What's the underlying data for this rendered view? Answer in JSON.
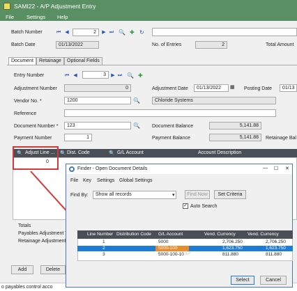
{
  "window": {
    "title": "SAMI22 - A/P Adjustment Entry"
  },
  "menu": [
    "File",
    "Settings",
    "Help"
  ],
  "batch": {
    "number_label": "Batch Number",
    "number_value": "2",
    "date_label": "Batch Date",
    "date_value": "01/13/2022",
    "entries_label": "No. of Entries",
    "entries_value": "2",
    "total_label": "Total Amount"
  },
  "tabs": [
    "Document",
    "Retainage",
    "Optional Fields"
  ],
  "entry": {
    "label": "Entry Number",
    "value": "3"
  },
  "adj_number": {
    "label": "Adjustment Number",
    "value": "0"
  },
  "adj_date": {
    "label": "Adjustment Date",
    "value": "01/13/2022"
  },
  "posting_date": {
    "label": "Posting Date",
    "value": "01/13"
  },
  "vendor": {
    "label": "Vendor No. *",
    "value": "1200",
    "name": "Chloride Systems"
  },
  "reference": {
    "label": "Reference"
  },
  "document_number": {
    "label": "Document Number *",
    "value": "123"
  },
  "document_balance": {
    "label": "Document Balance",
    "value": "5,141.88"
  },
  "payment_number": {
    "label": "Payment Number",
    "value": "1"
  },
  "payment_balance": {
    "label": "Payment Balance",
    "value": "5,141.88"
  },
  "retainage_bal_label": "Retainage Bal",
  "grid": {
    "headers": [
      "Adjust Line ...",
      "Dist. Code",
      "G/L Account",
      "Account Description"
    ],
    "first_cell": "0"
  },
  "totals": {
    "label": "Totals",
    "payables": "Payables Adjustment To",
    "retainage": "Retainage Adjustment T"
  },
  "buttons": {
    "add": "Add",
    "delete": "Delete"
  },
  "status_text": "o payables control acco",
  "finder": {
    "title": "Finder - Open Document Details",
    "menu": [
      "File",
      "Key",
      "Settings",
      "Global Settings"
    ],
    "find_by_label": "Find By:",
    "find_by_value": "Show all records",
    "find_now": "Find Now",
    "set_criteria": "Set Criteria",
    "auto_search": "Auto Search",
    "headers": [
      "Line Number",
      "Distribution Code",
      "G/L Account",
      "Vend. Currency",
      "Vend. Currency"
    ],
    "rows": [
      {
        "line": "1",
        "dist": "",
        "gl": "5000",
        "vc1": "2,706.250",
        "vc2": "2,706.250"
      },
      {
        "line": "2",
        "dist": "",
        "gl": "5000-100",
        "vc1": "1,623.750",
        "vc2": "1,623.750"
      },
      {
        "line": "3",
        "dist": "",
        "gl": "5000-100-10",
        "vc1": "811.880",
        "vc2": "811.880"
      }
    ],
    "select": "Select",
    "cancel": "Cancel"
  },
  "colors": {
    "title_green": "#5a8f64",
    "highlight_red": "#d23a3a",
    "select_blue": "#1f7bd8",
    "highlight_orange": "#e98c2c"
  }
}
